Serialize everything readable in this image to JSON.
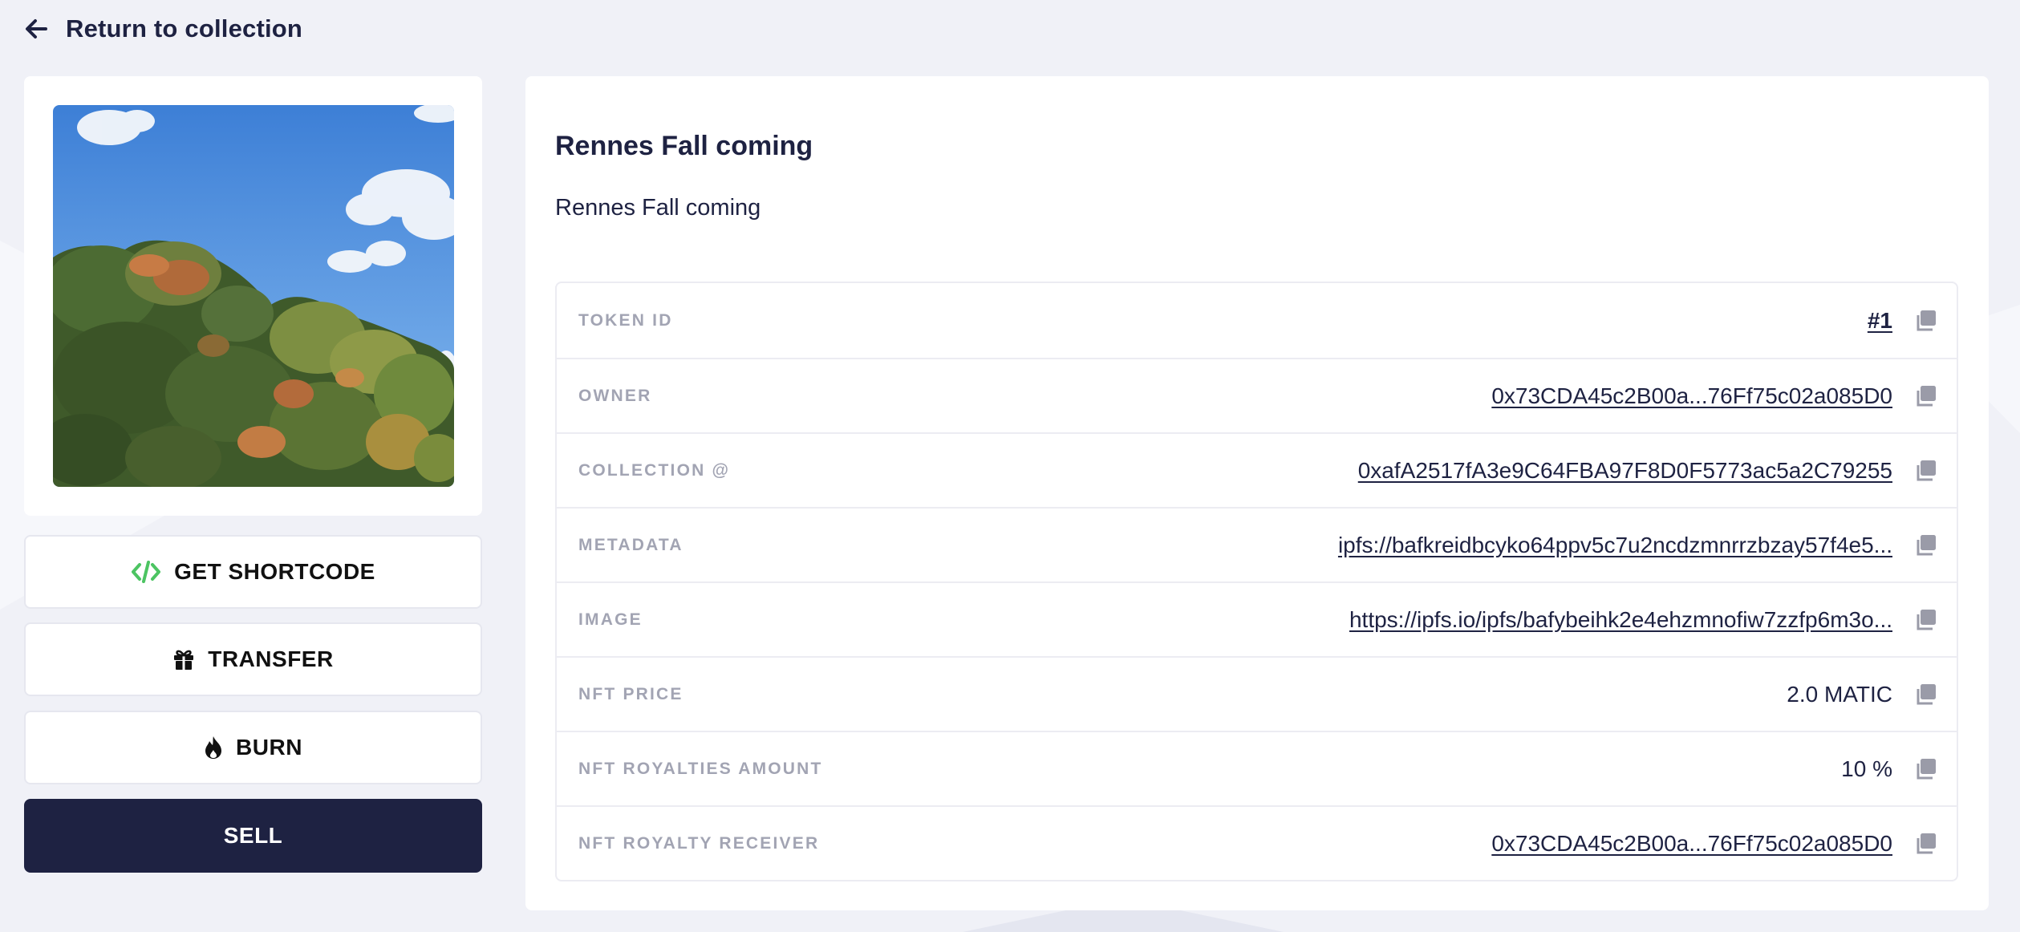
{
  "nav": {
    "back_label": "Return to collection"
  },
  "nft": {
    "title": "Rennes Fall coming",
    "description": "Rennes Fall coming",
    "image_alt_icon": "photo-sky-trees"
  },
  "actions": {
    "shortcode_label": "GET SHORTCODE",
    "transfer_label": "TRANSFER",
    "burn_label": "BURN",
    "sell_label": "SELL"
  },
  "properties": [
    {
      "label": "TOKEN ID",
      "value": "#1",
      "style": "link-bold"
    },
    {
      "label": "OWNER",
      "value": "0x73CDA45c2B00a...76Ff75c02a085D0",
      "style": "link"
    },
    {
      "label": "COLLECTION @",
      "value": "0xafA2517fA3e9C64FBA97F8D0F5773ac5a2C79255",
      "style": "link"
    },
    {
      "label": "METADATA",
      "value": "ipfs://bafkreidbcyko64ppv5c7u2ncdzmnrrzbzay57f4e5...",
      "style": "link"
    },
    {
      "label": "IMAGE",
      "value": "https://ipfs.io/ipfs/bafybeihk2e4ehzmnofiw7zzfp6m3o...",
      "style": "link"
    },
    {
      "label": "NFT PRICE",
      "value": "2.0 MATIC",
      "style": "plain"
    },
    {
      "label": "NFT ROYALTIES AMOUNT",
      "value": "10 %",
      "style": "plain"
    },
    {
      "label": "NFT ROYALTY RECEIVER",
      "value": "0x73CDA45c2B00a...76Ff75c02a085D0",
      "style": "link"
    }
  ],
  "colors": {
    "background": "#f0f1f7",
    "navy": "#1e2242",
    "label_gray": "#a2a4b3",
    "shortcode_green": "#4cc462",
    "copy_icon_gray": "#9a9ba8"
  }
}
